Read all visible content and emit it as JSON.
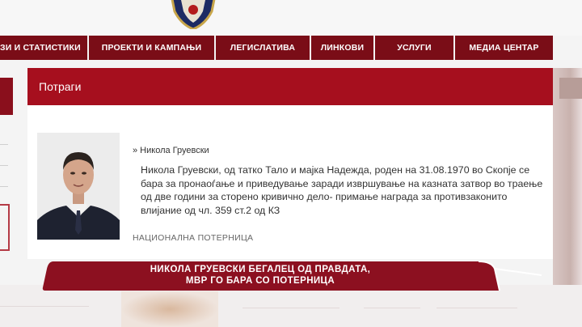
{
  "nav": {
    "items": [
      {
        "label": "ЗИ И СТАТИСТИКИ"
      },
      {
        "label": "ПРОЕКТИ И КАМПАЊИ"
      },
      {
        "label": "ЛЕГИСЛАТИВА"
      },
      {
        "label": "ЛИНКОВИ"
      },
      {
        "label": "УСЛУГИ"
      },
      {
        "label": "МЕДИА ЦЕНТАР"
      }
    ]
  },
  "panel": {
    "title": "Потраги",
    "breadcrumb": "» Никола Груевски",
    "description": "Никола Груевски, од татко Тало и мајка Надежда, роден на 31.08.1970 во Скопје се бара за пронаоѓање и приведување заради извршување на казната затвор во траење од две години за сторено кривично дело- примање награда за противзаконито влијание од чл. 359 ст.2 од КЗ",
    "category": "НАЦИОНАЛНА ПОТЕРНИЦА"
  },
  "banner": {
    "line1": "НИКОЛА ГРУЕВСКИ БЕГАЛЕЦ ОД ПРАВДАТА,",
    "line2": "МВР ГО БАРА СО ПОТЕРНИЦА"
  },
  "colors": {
    "nav_bg": "#7a0d17",
    "header_bg": "#a60f1e",
    "banner_bg": "#8c1020"
  },
  "icons": {
    "logo": "police-emblem-icon"
  }
}
